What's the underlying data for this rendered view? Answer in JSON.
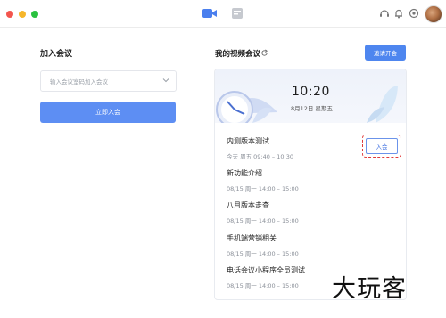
{
  "join": {
    "title": "加入会议",
    "placeholder": "输入会议室码加入会议",
    "button": "立即入会"
  },
  "meetings": {
    "title": "我的视频会议",
    "invite_button": "邀请开会",
    "clock": {
      "time": "10:20",
      "date": "8月12日 星期五"
    },
    "enter_button": "入会",
    "items": [
      {
        "title": "内测版本测试",
        "time": "今天  周五  09:40 – 10:30"
      },
      {
        "title": "新功能介绍",
        "time": "08/15  周一  14:00 – 15:00"
      },
      {
        "title": "八月版本走查",
        "time": "08/15  周一  14:00 – 15:00"
      },
      {
        "title": "手机端营销相关",
        "time": "08/15  周一  14:00 – 15:00"
      },
      {
        "title": "电话会议小程序全员测试",
        "time": "08/15  周一  14:00 – 15:00"
      }
    ]
  },
  "watermark": "大玩客",
  "colors": {
    "primary": "#5d8ef3",
    "invite": "#4e86ef",
    "highlight": "#e03a3a"
  },
  "icons": [
    "video-camera-icon",
    "calendar-icon",
    "refresh-icon",
    "bell-icon",
    "settings-icon",
    "headset-icon",
    "chevron-down-icon"
  ]
}
